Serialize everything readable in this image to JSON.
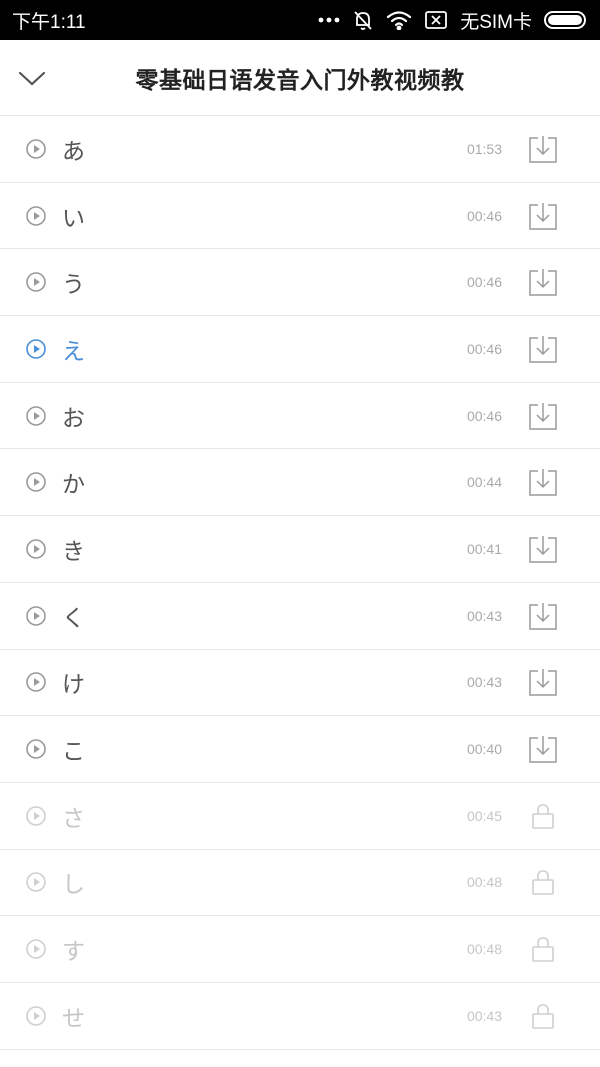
{
  "status_bar": {
    "time": "下午1:11",
    "carrier": "无SIM卡"
  },
  "header": {
    "title": "零基础日语发音入门外教视频教"
  },
  "colors": {
    "active": "#4a90d9",
    "normal_icon": "#9a9a9a",
    "locked": "#cfcfcf"
  },
  "items": [
    {
      "kana": "あ",
      "duration": "01:53",
      "state": "download"
    },
    {
      "kana": "い",
      "duration": "00:46",
      "state": "download"
    },
    {
      "kana": "う",
      "duration": "00:46",
      "state": "download"
    },
    {
      "kana": "え",
      "duration": "00:46",
      "state": "active"
    },
    {
      "kana": "お",
      "duration": "00:46",
      "state": "download"
    },
    {
      "kana": "か",
      "duration": "00:44",
      "state": "download"
    },
    {
      "kana": "き",
      "duration": "00:41",
      "state": "download"
    },
    {
      "kana": "く",
      "duration": "00:43",
      "state": "download"
    },
    {
      "kana": "け",
      "duration": "00:43",
      "state": "download"
    },
    {
      "kana": "こ",
      "duration": "00:40",
      "state": "download"
    },
    {
      "kana": "さ",
      "duration": "00:45",
      "state": "locked"
    },
    {
      "kana": "し",
      "duration": "00:48",
      "state": "locked"
    },
    {
      "kana": "す",
      "duration": "00:48",
      "state": "locked"
    },
    {
      "kana": "せ",
      "duration": "00:43",
      "state": "locked"
    }
  ]
}
